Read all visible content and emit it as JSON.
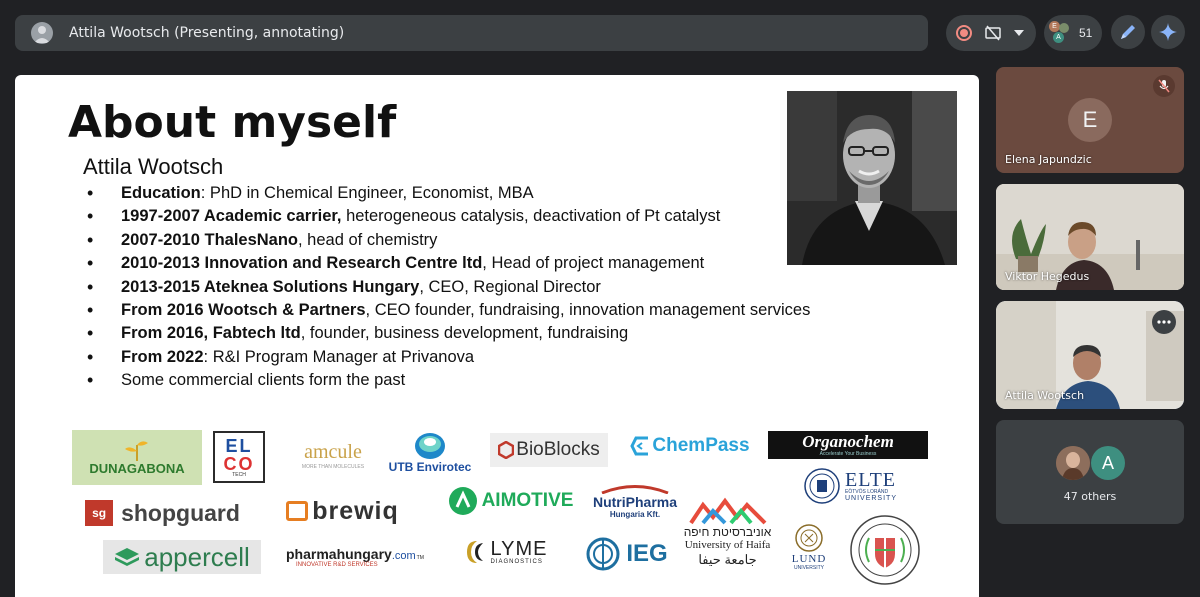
{
  "topbar": {
    "presenter_label": "Attila Wootsch (Presenting, annotating)",
    "participant_count": "51",
    "mini_avatars": [
      "E",
      "A"
    ]
  },
  "slide": {
    "title": "About myself",
    "subtitle": "Attila Wootsch",
    "bullets": [
      {
        "bold": "Education",
        "rest": ": PhD in Chemical Engineer, Economist, MBA"
      },
      {
        "bold": "1997-2007 Academic carrier,",
        "rest": " heterogeneous catalysis, deactivation of Pt catalyst"
      },
      {
        "bold": "2007-2010 ThalesNano",
        "rest": ", head of chemistry"
      },
      {
        "bold": "2010-2013 Innovation and Research Centre ltd",
        "rest": ", Head of project management"
      },
      {
        "bold": "2013-2015 Ateknea Solutions Hungary",
        "rest": ", CEO, Regional Director"
      },
      {
        "bold": "From 2016 Wootsch & Partners",
        "rest": ", CEO founder, fundraising, innovation management services"
      },
      {
        "bold": "From 2016, Fabtech ltd",
        "rest": ", founder, business development, fundraising"
      },
      {
        "bold": "From 2022",
        "rest": ": R&I Program Manager at Privanova"
      },
      {
        "bold": "",
        "rest": "Some commercial clients form the past"
      }
    ],
    "logos": {
      "dunagabona": "DUNAGABONA",
      "elco_top": "EL",
      "elco_bottom": "CO",
      "elco_tech": "TECH",
      "amcule": "amcule",
      "amcule_tag": "MORE THAN MOLECULES",
      "utb": "UTB Envirotec",
      "bioblocks": "BioBlocks",
      "chempass": "ChemPass",
      "organochem": "Organochem",
      "organochem_tag": "Accelerate Your Business",
      "elte": "ELTE",
      "elte_line1": "EÖTVÖS LORÁND",
      "elte_line2": "UNIVERSITY",
      "sg": "sg",
      "shopguard": "shopguard",
      "brewiq": "brewiq",
      "aimotive": "AIMOTIVE",
      "nutripharma": "NutriPharma",
      "nutripharma_sub": "Hungaria Kft.",
      "haifa_hebrew": "אוניברסיטת חיפה",
      "haifa_english": "University of Haifa",
      "haifa_arabic": "جامعة حيفا",
      "appercell": "appercell",
      "pharmahungary": "pharmahungary",
      "pharmahungary_com": ".com",
      "pharmahungary_tm": "TM",
      "pharmahungary_tag": "INNOVATIVE R&D SERVICES",
      "lyme": "LYME",
      "lyme_sub": "DIAGNOSTICS",
      "ieg": "IEG",
      "lund": "LUND",
      "lund_sub": "UNIVERSITY"
    }
  },
  "participants": [
    {
      "name": "Elena Japundzic",
      "initial": "E",
      "muted": true
    },
    {
      "name": "Viktor Hegedus"
    },
    {
      "name": "Attila Wootsch"
    }
  ],
  "others": {
    "label": "47 others",
    "initial": "A"
  },
  "colors": {
    "background": "#202124",
    "bar": "#3c4043",
    "accent_blue": "#8ab4f8",
    "record_red": "#f28b82",
    "elena_tile": "#6b4a3f"
  }
}
